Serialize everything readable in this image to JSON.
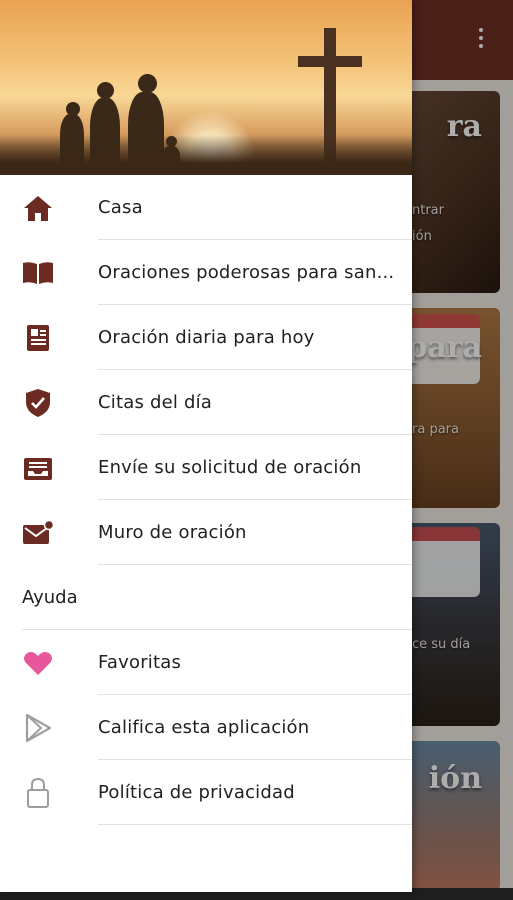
{
  "background": {
    "cards": [
      {
        "title": "ra",
        "subtitle_lines": [
          "ntrar",
          "ión"
        ]
      },
      {
        "title": "para",
        "subtitle_lines": [
          "ra para"
        ]
      },
      {
        "title": "",
        "subtitle_lines": [
          "ce su día"
        ]
      },
      {
        "title": "ión",
        "subtitle_lines": []
      }
    ],
    "colors": {
      "app_bar": "#6e2f24"
    }
  },
  "drawer": {
    "items": [
      {
        "label": "Casa",
        "icon": "home-icon"
      },
      {
        "label": "Oraciones poderosas para san...",
        "icon": "open-book-icon"
      },
      {
        "label": "Oración diaria para hoy",
        "icon": "newspaper-icon"
      },
      {
        "label": "Citas del día",
        "icon": "shield-check-icon"
      },
      {
        "label": "Envíe su solicitud de oración",
        "icon": "inbox-tray-icon"
      },
      {
        "label": "Muro de oración",
        "icon": "mail-notification-icon"
      }
    ],
    "help_section": {
      "title": "Ayuda",
      "items": [
        {
          "label": "Favoritas",
          "icon": "heart-icon"
        },
        {
          "label": "Califica esta aplicación",
          "icon": "play-store-icon"
        },
        {
          "label": "Política de privacidad",
          "icon": "lock-icon"
        }
      ]
    },
    "colors": {
      "icon": "#6b2b22",
      "heart": "#e8579b",
      "muted_icon": "#9e9e9e"
    }
  }
}
